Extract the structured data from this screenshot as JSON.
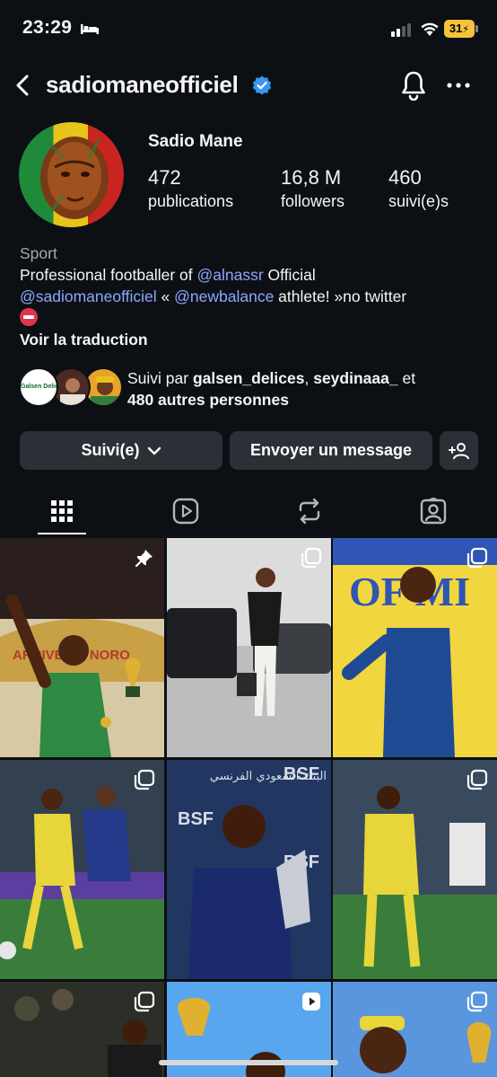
{
  "status_bar": {
    "time": "23:29",
    "battery": "31"
  },
  "header": {
    "username": "sadiomaneofficiel"
  },
  "profile": {
    "full_name": "Sadio Mane",
    "stats": [
      {
        "num": "472",
        "label": "publications"
      },
      {
        "num": "16,8 M",
        "label": "followers"
      },
      {
        "num": "460",
        "label": "suivi(e)s"
      }
    ],
    "category": "Sport",
    "bio": {
      "line1_a": "Professional footballer of ",
      "line1_link": "@alnassr",
      "line1_b": " Official",
      "line2_link1": "@sadiomaneofficiel",
      "line2_mid": " «  ",
      "line2_link2": "@newbalance",
      "line2_end": " athlete! »no twitter"
    },
    "translate": "Voir la traduction",
    "followed_by": {
      "prefix": "Suivi par ",
      "user1": "galsen_delices",
      "sep": ", ",
      "user2": "seydinaaa_",
      "suffix": " et",
      "others": "480 autres personnes",
      "avatar1_text": "Galsen Delices"
    }
  },
  "actions": {
    "following_label": "Suivi(e)",
    "message_label": "Envoyer un message"
  },
  "tabs": [
    "grid-icon",
    "reels-icon",
    "reposts-icon",
    "tagged-icon"
  ],
  "grid": {
    "posts": [
      {
        "type": "pinned",
        "arabic": "",
        "brand": "ARRIVE OF NORO"
      },
      {
        "type": "carousel",
        "arabic": ""
      },
      {
        "type": "carousel",
        "arabic": "",
        "brand": "OF MI"
      },
      {
        "type": "carousel",
        "arabic": ""
      },
      {
        "type": "single",
        "arabic": "البنك السعودي الفرنسي",
        "brand": "BSF"
      },
      {
        "type": "carousel",
        "arabic": ""
      },
      {
        "type": "carousel",
        "arabic": ""
      },
      {
        "type": "reel",
        "arabic": ""
      },
      {
        "type": "carousel",
        "arabic": ""
      }
    ]
  },
  "colors": {
    "background": "#0c1014",
    "button": "#2b3036",
    "link": "#8ea6ff",
    "verified": "#3897f0",
    "battery": "#f5c23a"
  }
}
